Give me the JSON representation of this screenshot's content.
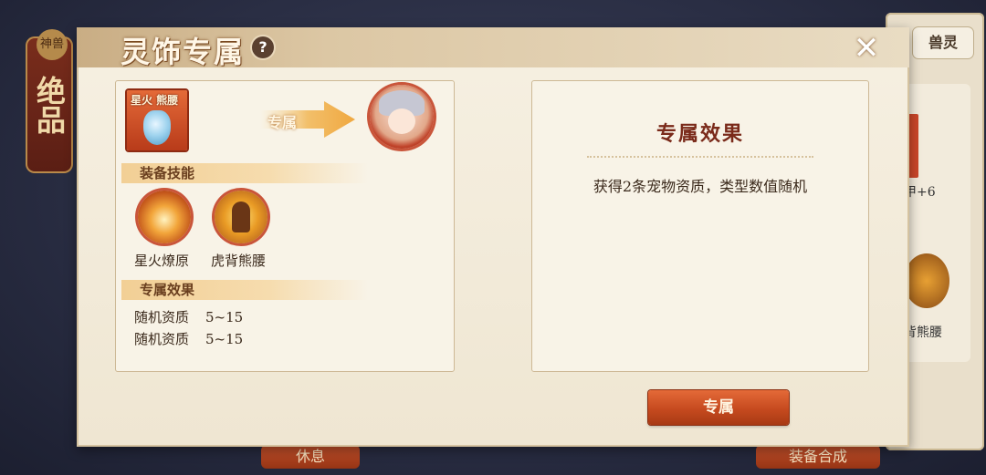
{
  "background": {
    "left_badge_text": "绝品",
    "left_small_badge_text": "神兽",
    "right_tab_label": "兽灵",
    "right_card_text_1": "甲+6",
    "right_card_text_2": "背熊腰",
    "bottom_button_left_label": "休息",
    "bottom_button_right_label": "装备合成"
  },
  "dialog": {
    "title": "灵饰专属",
    "help_icon": "?",
    "close_icon": "✕"
  },
  "left_panel": {
    "item_name": "星火 熊腰",
    "arrow_label": "专属",
    "equip_skills_heading": "装备技能",
    "skills": [
      {
        "name": "星火燎原",
        "icon": "flame-burst-icon"
      },
      {
        "name": "虎背熊腰",
        "icon": "strong-figure-icon"
      }
    ],
    "exclusive_effect_heading": "专属效果",
    "stats": [
      {
        "label": "随机资质",
        "value": "5~15"
      },
      {
        "label": "随机资质",
        "value": "5~15"
      }
    ]
  },
  "right_panel": {
    "title": "专属效果",
    "description": "获得2条宠物资质，类型数值随机"
  },
  "action_button": {
    "label": "专属"
  },
  "colors": {
    "accent_orange": "#c64a1f",
    "title_red": "#7a2a1a",
    "parchment": "#f8f3e7"
  }
}
